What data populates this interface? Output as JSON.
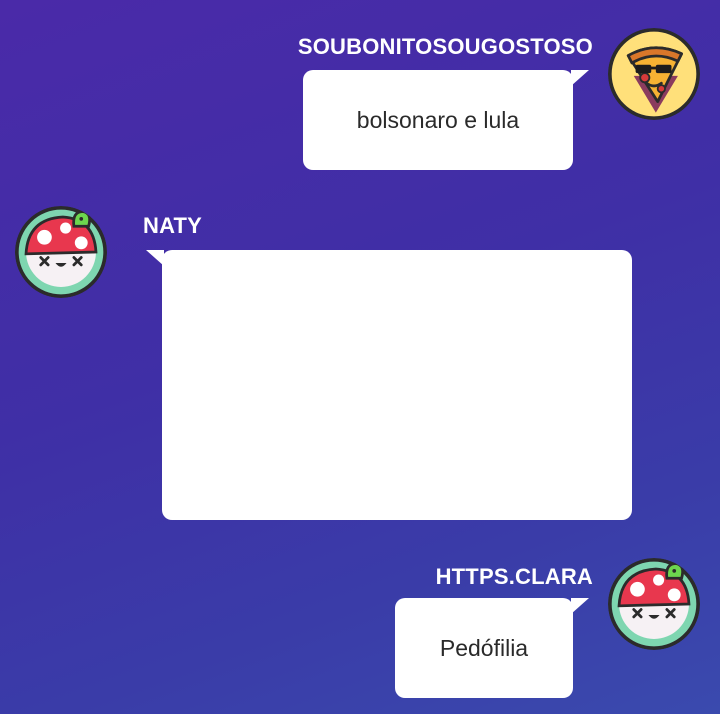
{
  "messages": [
    {
      "user": "SOUBONITOSOUGOSTOSO",
      "text": "bolsonaro e lula",
      "avatar": "pizza-sunglasses-icon",
      "side": "right"
    },
    {
      "user": "NATY",
      "text": "",
      "avatar": "mushroom-icon",
      "side": "left"
    },
    {
      "user": "HTTPS.CLARA",
      "text": "Pedófilia",
      "avatar": "mushroom-icon",
      "side": "right"
    }
  ],
  "colors": {
    "background_top": "#4a2aa8",
    "background_bottom": "#3a4aae",
    "bubble": "#ffffff",
    "mushroom_cap": "#e8374e",
    "pizza_circle": "#ffe07a"
  }
}
